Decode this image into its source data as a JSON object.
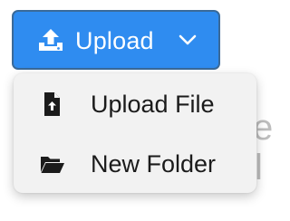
{
  "colors": {
    "accent": "#2f8cf0",
    "menu_background": "#f2f2f2",
    "text": "#1b1b1b"
  },
  "upload_button": {
    "label": "Upload",
    "icon": "upload-icon",
    "dropdown_icon": "chevron-down-icon"
  },
  "dropdown_menu": {
    "items": [
      {
        "label": "Upload File",
        "icon": "file-upload-icon"
      },
      {
        "label": "New Folder",
        "icon": "folder-open-icon"
      }
    ]
  },
  "background_text": {
    "line1": "e",
    "line2": "l"
  }
}
